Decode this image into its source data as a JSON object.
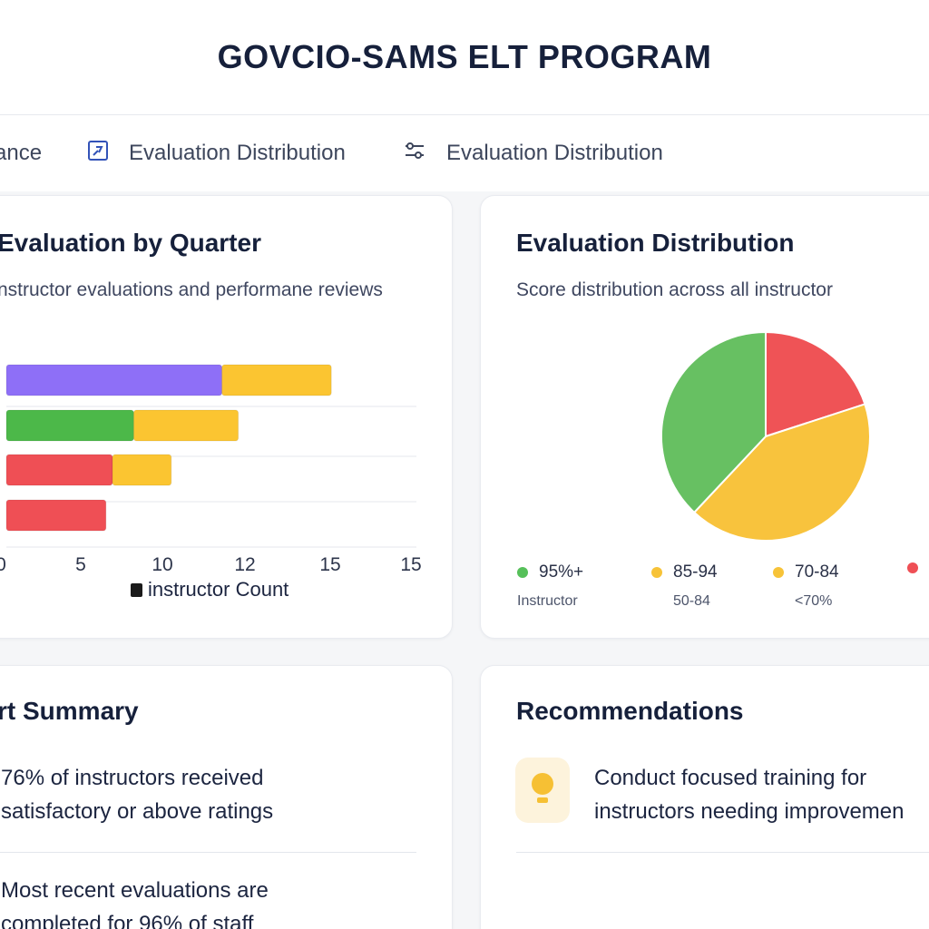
{
  "app": {
    "title": "GOVCIO-SAMS ELT PROGRAM"
  },
  "tabs": [
    {
      "label": "ance",
      "icon": ""
    },
    {
      "label": "Evaluation  Distribution",
      "icon": "chart-box-icon"
    },
    {
      "label": "Evaluation Distribution",
      "icon": "sliders-icon"
    }
  ],
  "bar_card": {
    "title": "Evaluation by Quarter",
    "subtitle": "nstructor evaluations and performane reviews",
    "legend_label": "instructor Count"
  },
  "pie_card": {
    "title": "Evaluation Distribution",
    "subtitle": "Score distribution across all instructor",
    "legend": [
      {
        "label": "95%+",
        "sub": "Instructor",
        "color": "#56c05a"
      },
      {
        "label": "85-94",
        "sub": "50-84",
        "color": "#f7c338"
      },
      {
        "label": "70-84",
        "sub": "<70%",
        "color": "#f7c338"
      },
      {
        "label": "",
        "sub": "",
        "color": "#ef4f55"
      }
    ]
  },
  "summary_card": {
    "title": "rt Summary",
    "items": [
      "76% of instructors received satisfactory or above ratings",
      "Most recent evaluations are completed for 96% of staff"
    ]
  },
  "rec_card": {
    "title": "Recommendations",
    "items": [
      {
        "text": "Conduct focused training for instructors needing improvemen",
        "icon": "lightbulb-icon"
      }
    ]
  },
  "chart_data": [
    {
      "type": "bar",
      "orientation": "horizontal",
      "stacked": true,
      "title": "Evaluation by Quarter",
      "xlabel": "",
      "ylabel": "",
      "x_ticks": [
        "0",
        "5",
        "10",
        "12",
        "15",
        "15"
      ],
      "xlim": [
        0,
        25
      ],
      "grid": true,
      "legend": [
        "instructor Count"
      ],
      "rows": [
        {
          "segments": [
            {
              "value": 13.2,
              "color": "#8e6ff7"
            },
            {
              "value": 6.7,
              "color": "#fbc531"
            }
          ]
        },
        {
          "segments": [
            {
              "value": 7.8,
              "color": "#4cb849"
            },
            {
              "value": 6.4,
              "color": "#fbc531"
            }
          ]
        },
        {
          "segments": [
            {
              "value": 6.5,
              "color": "#ef4f55"
            },
            {
              "value": 3.6,
              "color": "#fbc531"
            }
          ]
        },
        {
          "segments": [
            {
              "value": 6.1,
              "color": "#ef4f55"
            }
          ]
        }
      ]
    },
    {
      "type": "pie",
      "title": "Evaluation Distribution",
      "slices": [
        {
          "label": "",
          "value": 20,
          "color": "#ef5356"
        },
        {
          "label": "",
          "value": 42,
          "color": "#f8c33d"
        },
        {
          "label": "",
          "value": 38,
          "color": "#67c062"
        }
      ]
    }
  ]
}
